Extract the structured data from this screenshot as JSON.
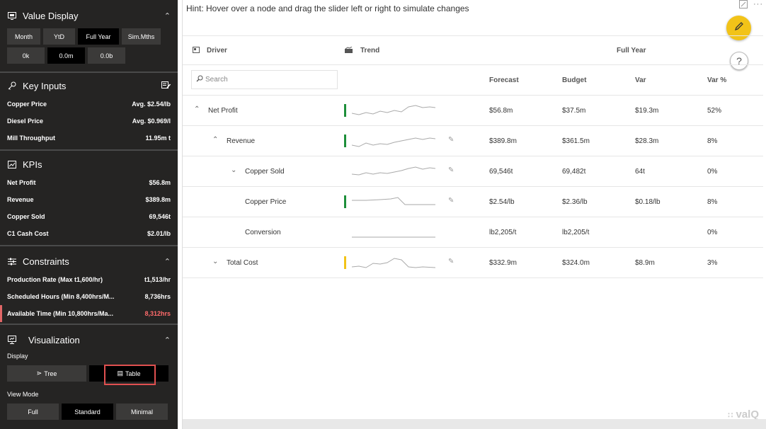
{
  "hint": "Hint: Hover over a node and drag the slider left or right to simulate changes",
  "sidebar": {
    "value_display": {
      "title": "Value Display",
      "periods": [
        {
          "label": "Month",
          "active": false
        },
        {
          "label": "YtD",
          "active": false
        },
        {
          "label": "Full Year",
          "active": true
        },
        {
          "label": "Sim.Mths",
          "active": false
        }
      ],
      "scales": [
        {
          "label": "0k",
          "active": false
        },
        {
          "label": "0.0m",
          "active": true
        },
        {
          "label": "0.0b",
          "active": false
        }
      ]
    },
    "key_inputs": {
      "title": "Key Inputs",
      "items": [
        {
          "label": "Copper Price",
          "value": "Avg. $2.54/lb"
        },
        {
          "label": "Diesel Price",
          "value": "Avg. $0.969/l"
        },
        {
          "label": "Mill Throughput",
          "value": "11.95m t"
        }
      ]
    },
    "kpis": {
      "title": "KPIs",
      "items": [
        {
          "label": "Net Profit",
          "value": "$56.8m"
        },
        {
          "label": "Revenue",
          "value": "$389.8m"
        },
        {
          "label": "Copper Sold",
          "value": "69,546t"
        },
        {
          "label": "C1 Cash Cost",
          "value": "$2.01/lb"
        }
      ]
    },
    "constraints": {
      "title": "Constraints",
      "items": [
        {
          "label": "Production Rate (Max t1,600/hr)",
          "value": "t1,513/hr"
        },
        {
          "label": "Scheduled Hours (Min 8,400hrs/M...",
          "value": "8,736hrs"
        },
        {
          "label": "Available Time (Min 10,800hrs/Ma...",
          "value": "8,312hrs"
        }
      ]
    },
    "visualization": {
      "title": "Visualization",
      "display_label": "Display",
      "display_options": [
        {
          "label": "Tree",
          "active": false
        },
        {
          "label": "Table",
          "active": true
        }
      ],
      "view_mode_label": "View Mode",
      "view_modes": [
        {
          "label": "Full",
          "active": false
        },
        {
          "label": "Standard",
          "active": true
        },
        {
          "label": "Minimal",
          "active": false
        }
      ]
    }
  },
  "table": {
    "driver_label": "Driver",
    "trend_label": "Trend",
    "period_label": "Full Year",
    "search_placeholder": "Search",
    "columns": [
      "Forecast",
      "Budget",
      "Var",
      "Var %"
    ],
    "rows": [
      {
        "name": "Net Profit",
        "forecast": "$56.8m",
        "budget": "$37.5m",
        "var": "$19.3m",
        "var_pct": "52%",
        "status_color": "#1e8f3a"
      },
      {
        "name": "Revenue",
        "forecast": "$389.8m",
        "budget": "$361.5m",
        "var": "$28.3m",
        "var_pct": "8%",
        "status_color": "#1e8f3a"
      },
      {
        "name": "Copper Sold",
        "forecast": "69,546t",
        "budget": "69,482t",
        "var": "64t",
        "var_pct": "0%",
        "status_color": ""
      },
      {
        "name": "Copper Price",
        "forecast": "$2.54/lb",
        "budget": "$2.36/lb",
        "var": "$0.18/lb",
        "var_pct": "8%",
        "status_color": "#1e8f3a"
      },
      {
        "name": "Conversion",
        "forecast": "lb2,205/t",
        "budget": "lb2,205/t",
        "var": "",
        "var_pct": "0%",
        "status_color": ""
      },
      {
        "name": "Total Cost",
        "forecast": "$332.9m",
        "budget": "$324.0m",
        "var": "$8.9m",
        "var_pct": "3%",
        "status_color": "#f2c318"
      }
    ]
  },
  "logo": "valQ"
}
